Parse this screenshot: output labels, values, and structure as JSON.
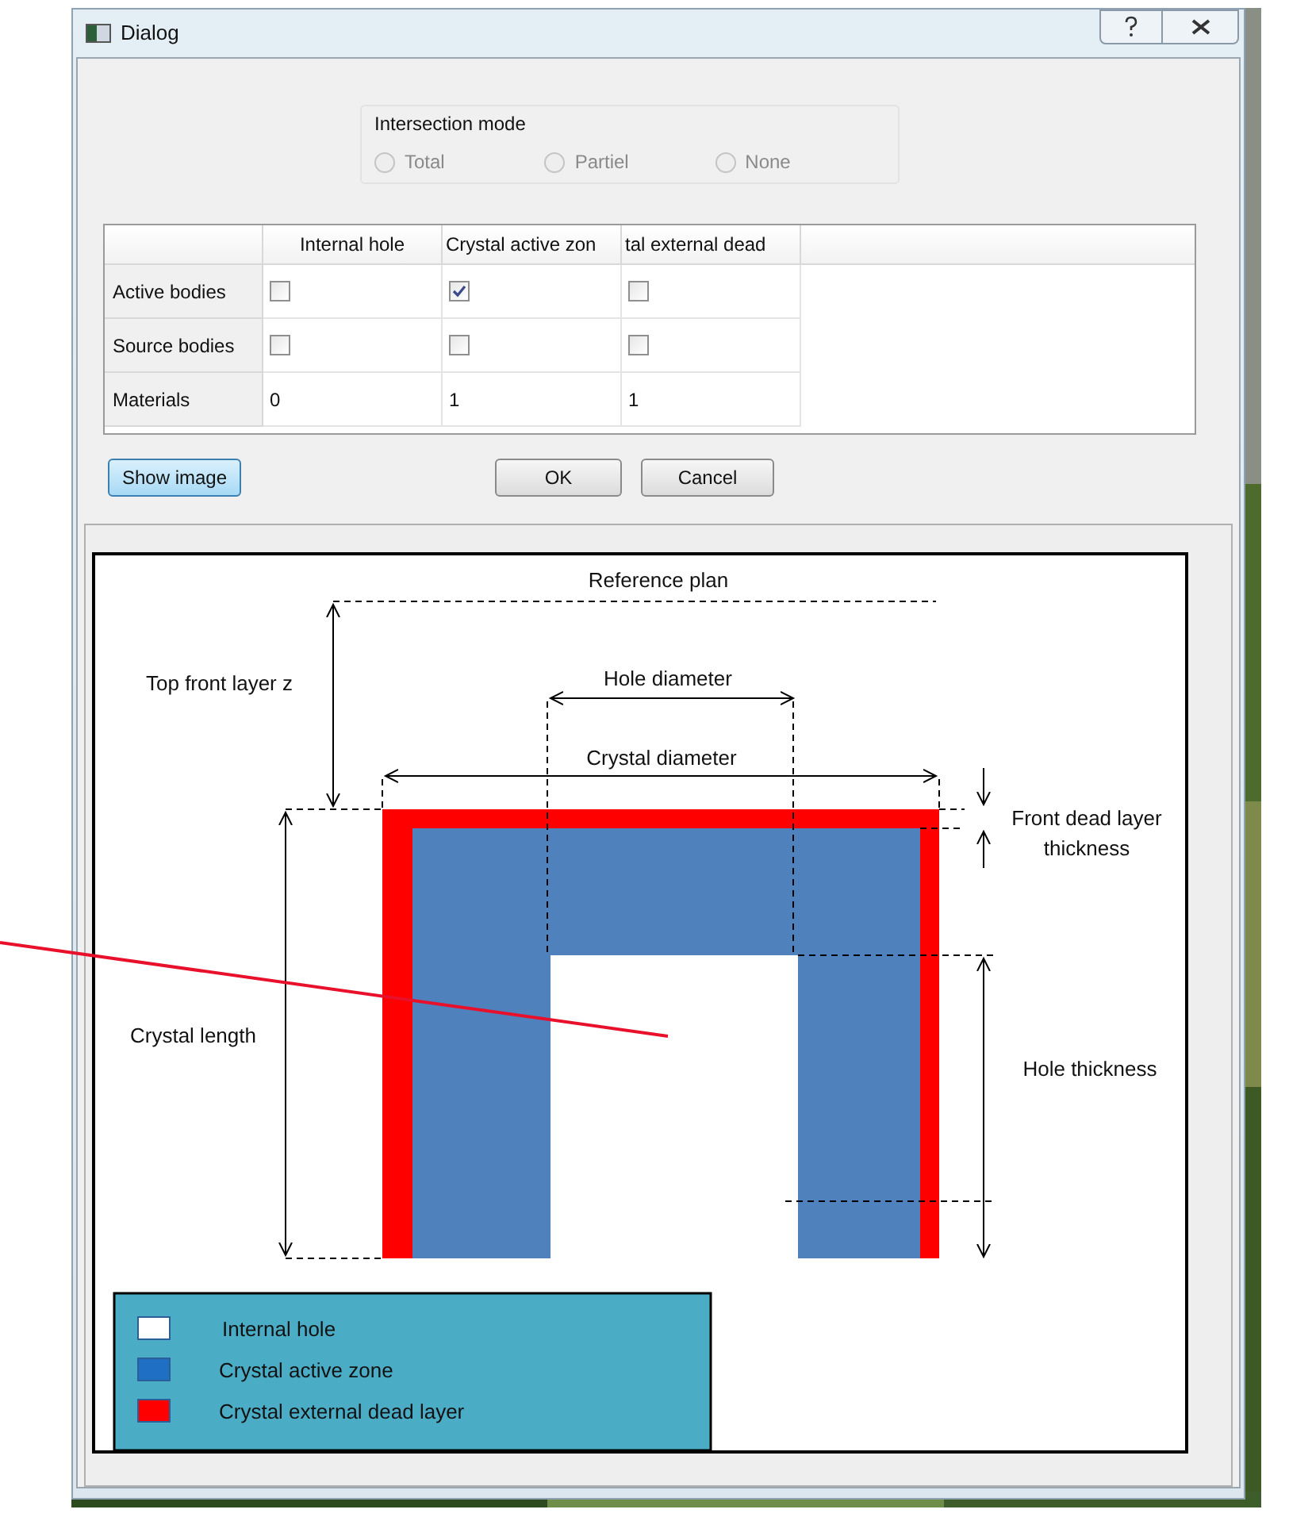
{
  "window": {
    "title": "Dialog"
  },
  "intersection_mode": {
    "title": "Intersection mode",
    "options": [
      {
        "label": "Total",
        "selected": false,
        "disabled": true
      },
      {
        "label": "Partiel",
        "selected": false,
        "disabled": true
      },
      {
        "label": "None",
        "selected": false,
        "disabled": true
      }
    ]
  },
  "table": {
    "columns": [
      "Internal hole",
      "Crystal active zon",
      "tal external dead"
    ],
    "rows": [
      {
        "header": "Active bodies",
        "cells": [
          {
            "kind": "checkbox",
            "checked": false
          },
          {
            "kind": "checkbox",
            "checked": true
          },
          {
            "kind": "checkbox",
            "checked": false
          }
        ]
      },
      {
        "header": "Source bodies",
        "cells": [
          {
            "kind": "checkbox",
            "checked": false
          },
          {
            "kind": "checkbox",
            "checked": false
          },
          {
            "kind": "checkbox",
            "checked": false
          }
        ]
      },
      {
        "header": "Materials",
        "cells": [
          {
            "kind": "text",
            "text": "0"
          },
          {
            "kind": "text",
            "text": "1"
          },
          {
            "kind": "text",
            "text": "1"
          }
        ]
      }
    ]
  },
  "buttons": [
    {
      "label": "Show image",
      "focused": true
    },
    {
      "label": "OK",
      "focused": false
    },
    {
      "label": "Cancel",
      "focused": false
    }
  ],
  "diagram": {
    "labels": {
      "reference_plan": "Reference plan",
      "top_front_layer_z": "Top front layer z",
      "hole_diameter": "Hole diameter",
      "crystal_diameter": "Crystal diameter",
      "front_dead_layer_thickness": [
        "Front dead layer",
        "thickness"
      ],
      "crystal_length": "Crystal length",
      "hole_thickness": "Hole thickness"
    },
    "legend": [
      {
        "label": "Internal hole",
        "color": "#ffffff"
      },
      {
        "label": "Crystal active zone",
        "color": "#1f6fc4"
      },
      {
        "label": "Crystal external dead layer",
        "color": "#ff0000"
      }
    ]
  }
}
